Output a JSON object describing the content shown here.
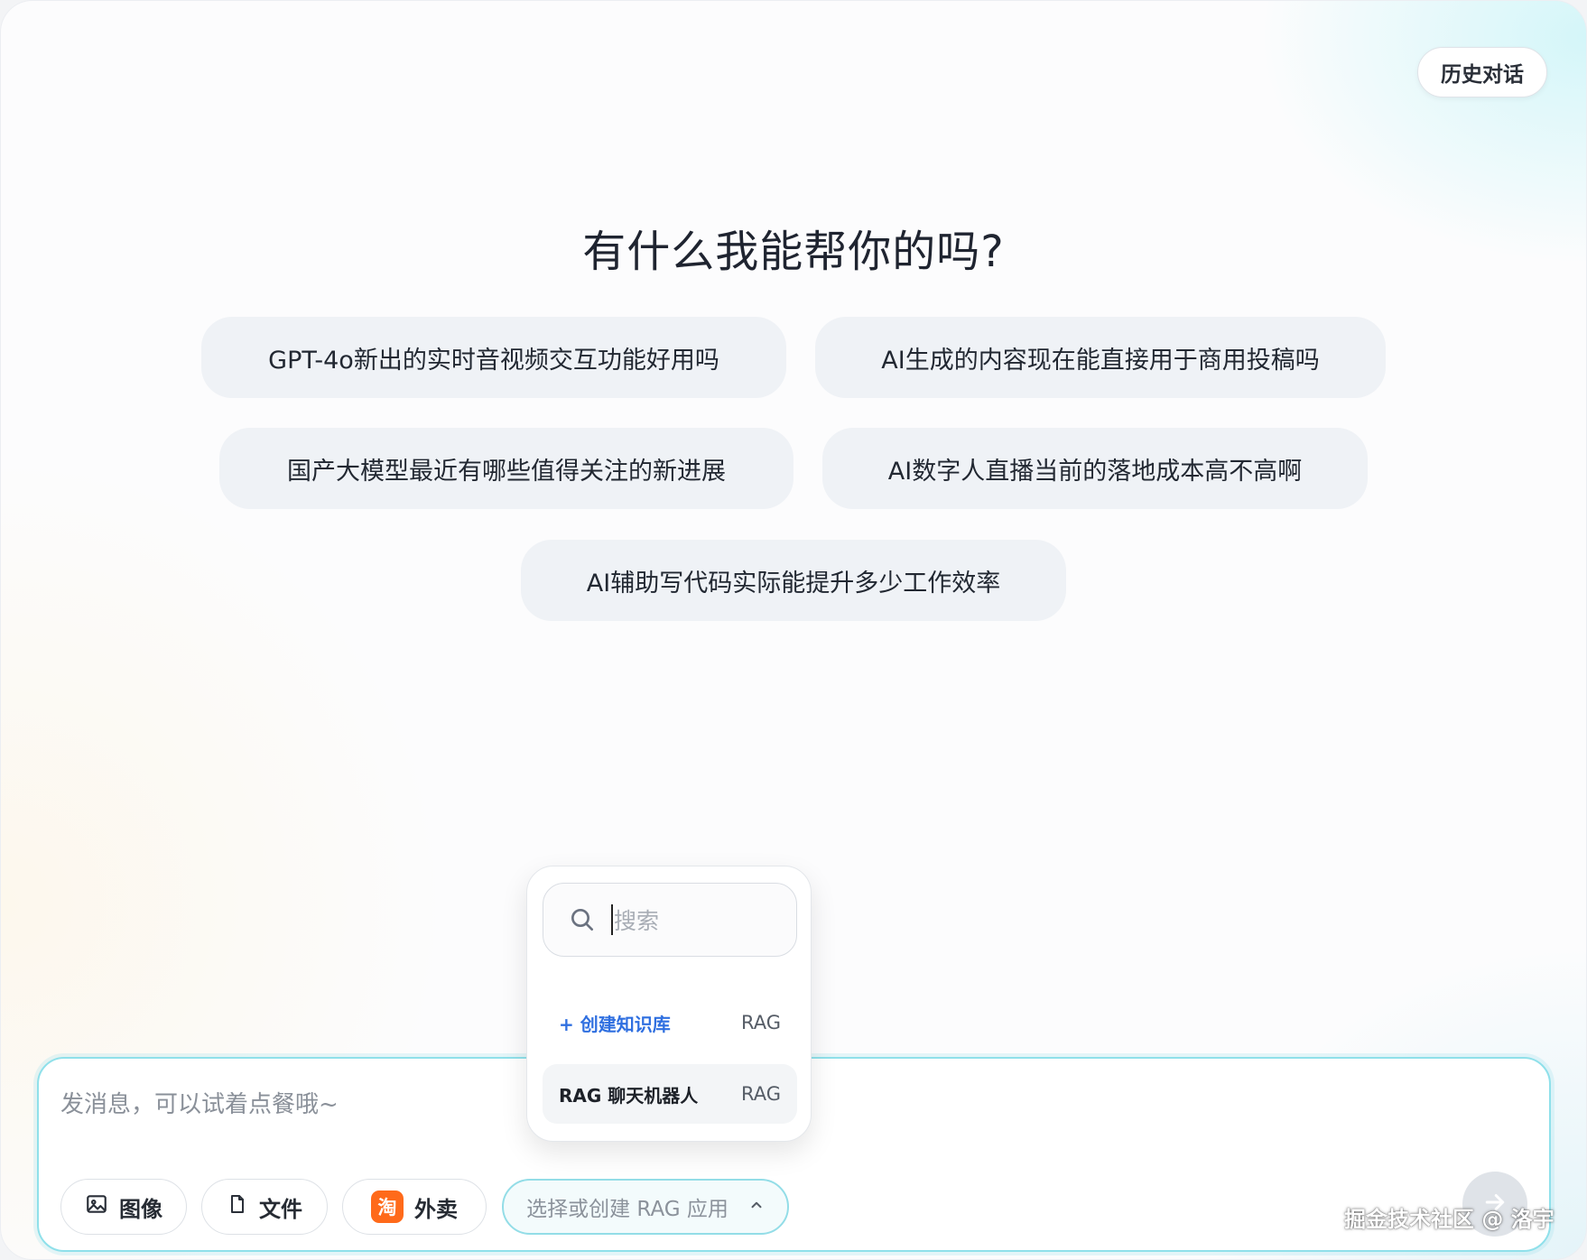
{
  "header": {
    "history_label": "历史对话"
  },
  "main": {
    "title": "有什么我能帮你的吗?",
    "suggestions": [
      "GPT-4o新出的实时音视频交互功能好用吗",
      "AI生成的内容现在能直接用于商用投稿吗",
      "国产大模型最近有哪些值得关注的新进展",
      "AI数字人直播当前的落地成本高不高啊",
      "AI辅助写代码实际能提升多少工作效率"
    ]
  },
  "composer": {
    "placeholder": "发消息，可以试着点餐哦~",
    "tools": {
      "image_label": "图像",
      "file_label": "文件",
      "takeout_label": "外卖",
      "takeout_badge": "淘"
    },
    "rag_select_label": "选择或创建 RAG 应用"
  },
  "rag_popover": {
    "search_placeholder": "搜索",
    "create_label": "+ 创建知识库",
    "create_tag": "RAG",
    "items": [
      {
        "label": "RAG 聊天机器人",
        "tag": "RAG"
      }
    ]
  },
  "watermark": "掘金技术社区 @ 洛宇",
  "colors": {
    "accent_border": "#8fe0ea",
    "create_link": "#2f6fe0",
    "chip_bg": "#eff2f6",
    "takeout_badge": "#ff6a1a"
  },
  "icons": {
    "search": "search-icon",
    "image": "image-icon",
    "file": "file-icon",
    "chevron": "chevron-up-icon",
    "send": "arrow-right-icon"
  }
}
